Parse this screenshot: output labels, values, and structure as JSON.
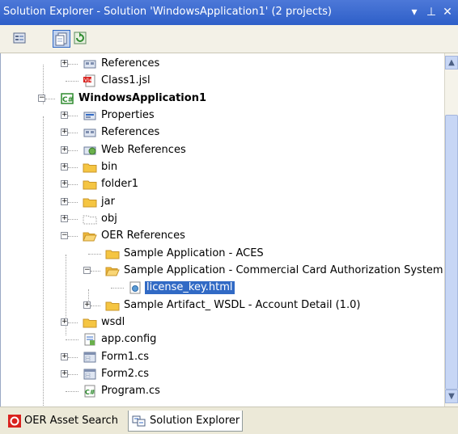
{
  "window": {
    "title": "Solution Explorer - Solution 'WindowsApplication1' (2 projects)",
    "buttons": {
      "dropdown": "▾",
      "pin": "⊥",
      "close": "✕"
    }
  },
  "toolbar": {
    "tools": [
      {
        "name": "properties-tool",
        "icon": "properties-icon",
        "selected": false
      },
      {
        "name": "show-all-files-tool",
        "icon": "show-all-files-icon",
        "selected": true
      },
      {
        "name": "refresh-tool",
        "icon": "refresh-icon",
        "selected": false
      }
    ]
  },
  "tree": {
    "rows": [
      {
        "label": "References",
        "icon": "references-icon",
        "expander": "+"
      },
      {
        "label": "Class1.jsl",
        "icon": "jsl-file-icon",
        "expander": ""
      },
      {
        "label": "WindowsApplication1",
        "icon": "csharp-project-icon",
        "expander": "−",
        "bold": true
      },
      {
        "label": "Properties",
        "icon": "properties-folder-icon",
        "expander": "+"
      },
      {
        "label": "References",
        "icon": "references-icon",
        "expander": "+"
      },
      {
        "label": "Web References",
        "icon": "web-references-icon",
        "expander": "+"
      },
      {
        "label": "bin",
        "icon": "folder-icon",
        "expander": "+"
      },
      {
        "label": "folder1",
        "icon": "folder-icon",
        "expander": "+"
      },
      {
        "label": "jar",
        "icon": "folder-icon",
        "expander": "+"
      },
      {
        "label": "obj",
        "icon": "hidden-folder-icon",
        "expander": "+"
      },
      {
        "label": "OER References",
        "icon": "open-folder-icon",
        "expander": "−"
      },
      {
        "label": "Sample Application - ACES",
        "icon": "folder-icon",
        "expander": ""
      },
      {
        "label": "Sample Application - Commercial Card Authorization System",
        "icon": "open-folder-icon",
        "expander": "−"
      },
      {
        "label": "license_key.html",
        "icon": "html-file-icon",
        "expander": "",
        "selected": true
      },
      {
        "label": "Sample Artifact_ WSDL - Account Detail (1.0)",
        "icon": "folder-icon",
        "expander": "+"
      },
      {
        "label": "wsdl",
        "icon": "folder-icon",
        "expander": "+"
      },
      {
        "label": "app.config",
        "icon": "config-file-icon",
        "expander": ""
      },
      {
        "label": "Form1.cs",
        "icon": "form-file-icon",
        "expander": "+"
      },
      {
        "label": "Form2.cs",
        "icon": "form-file-icon",
        "expander": "+"
      },
      {
        "label": "Program.cs",
        "icon": "csharp-file-icon",
        "expander": ""
      }
    ]
  },
  "scrollbar": {
    "up": "▲",
    "down": "▼"
  },
  "tabs": [
    {
      "label": "OER Asset Search",
      "icon": "oer-icon",
      "active": false
    },
    {
      "label": "Solution Explorer",
      "icon": "solution-explorer-icon",
      "active": true
    }
  ],
  "colors": {
    "titlebar": "#2e5fc8",
    "selection": "#316ac5",
    "folder": "#f5c542"
  }
}
